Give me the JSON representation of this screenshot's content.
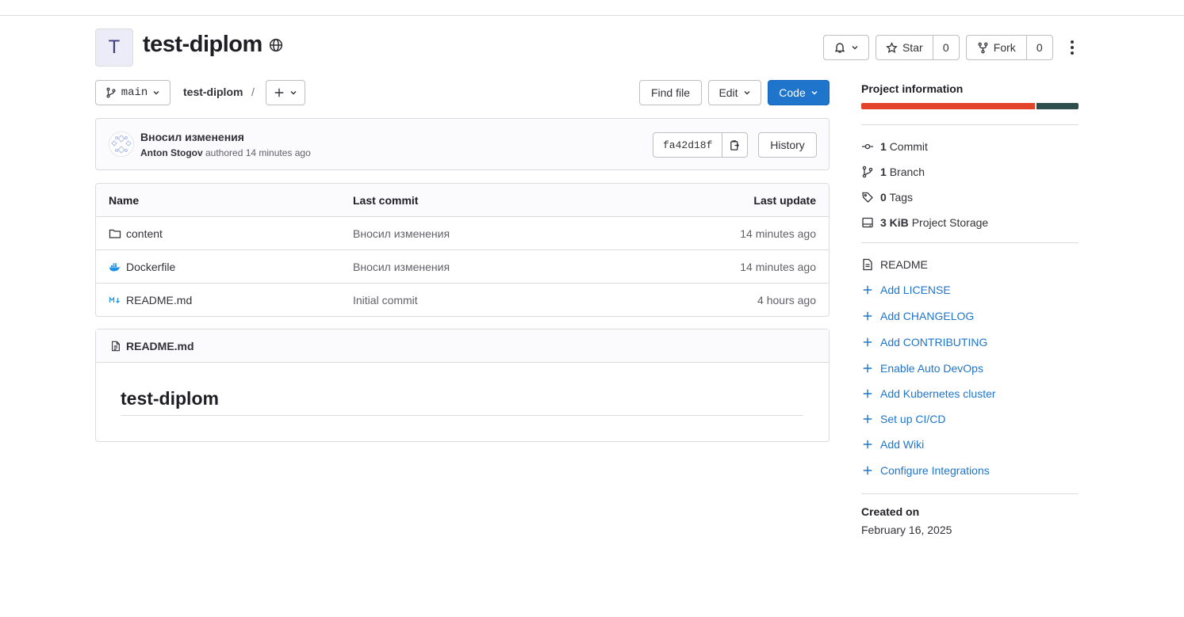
{
  "project": {
    "avatar_letter": "T",
    "name": "test-diplom"
  },
  "actions": {
    "star_label": "Star",
    "star_count": "0",
    "fork_label": "Fork",
    "fork_count": "0"
  },
  "repo_nav": {
    "branch": "main",
    "breadcrumb": "test-diplom",
    "separator": "/",
    "find_file": "Find file",
    "edit": "Edit",
    "code": "Code"
  },
  "last_commit": {
    "title": "Вносил изменения",
    "author": "Anton Stogov",
    "authored_text": "authored 14 minutes ago",
    "sha": "fa42d18f",
    "history_label": "History"
  },
  "file_tree": {
    "headers": [
      "Name",
      "Last commit",
      "Last update"
    ],
    "rows": [
      {
        "name": "content",
        "icon": "folder-icon",
        "commit": "Вносил изменения",
        "updated": "14 minutes ago"
      },
      {
        "name": "Dockerfile",
        "icon": "docker-icon",
        "commit": "Вносил изменения",
        "updated": "14 minutes ago"
      },
      {
        "name": "README.md",
        "icon": "markdown-icon",
        "commit": "Initial commit",
        "updated": "4 hours ago"
      }
    ]
  },
  "readme": {
    "filename": "README.md",
    "heading": "test-diplom"
  },
  "sidebar": {
    "title": "Project information",
    "languages": [
      {
        "color": "#e24329",
        "share": 0.806
      },
      {
        "color": "#2f4f4f",
        "share": 0.194
      }
    ],
    "stats": [
      {
        "icon": "commit-icon",
        "value": "1",
        "label": "Commit"
      },
      {
        "icon": "branch-icon",
        "value": "1",
        "label": "Branch"
      },
      {
        "icon": "tag-icon",
        "value": "0",
        "label": "Tags"
      },
      {
        "icon": "storage-icon",
        "value": "3 KiB",
        "label": "Project Storage"
      }
    ],
    "readme_link": "README",
    "links": [
      "Add LICENSE",
      "Add CHANGELOG",
      "Add CONTRIBUTING",
      "Enable Auto DevOps",
      "Add Kubernetes cluster",
      "Set up CI/CD",
      "Add Wiki",
      "Configure Integrations"
    ],
    "created_label": "Created on",
    "created_date": "February 16, 2025"
  },
  "colors": {
    "primary": "#1f75cb",
    "link": "#1f75cb",
    "border": "#dcdcde"
  }
}
